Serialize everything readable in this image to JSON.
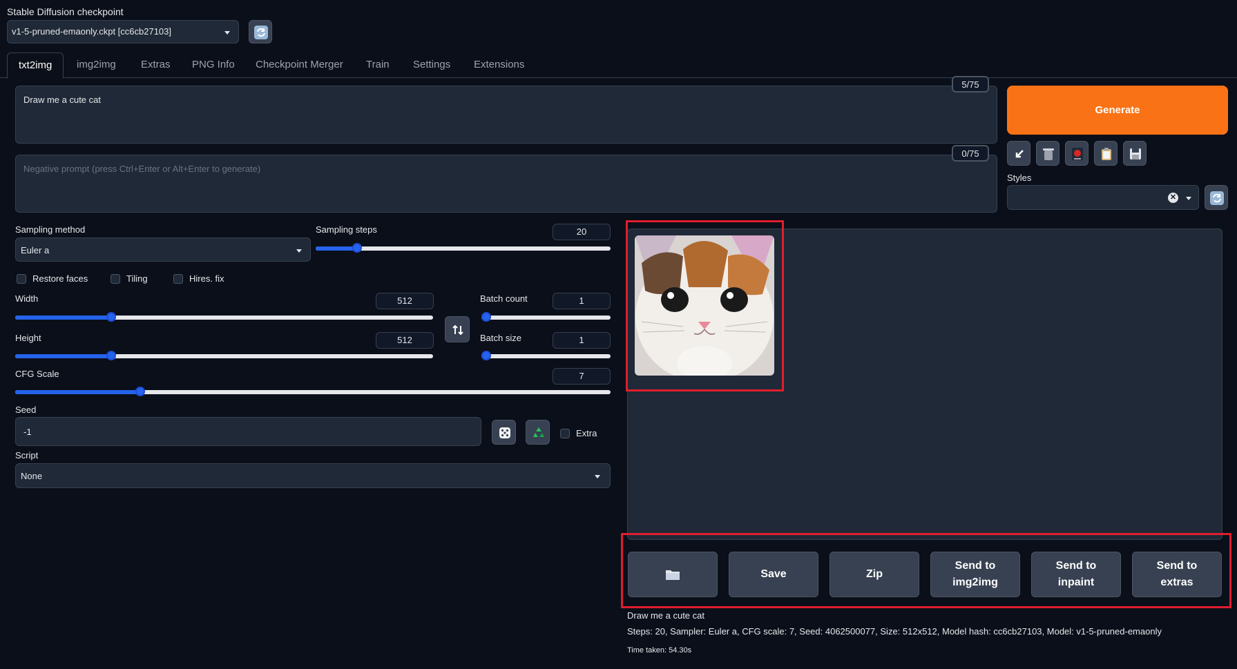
{
  "checkpoint": {
    "label": "Stable Diffusion checkpoint",
    "value": "v1-5-pruned-emaonly.ckpt [cc6cb27103]"
  },
  "tabs": [
    {
      "label": "txt2img"
    },
    {
      "label": "img2img"
    },
    {
      "label": "Extras"
    },
    {
      "label": "PNG Info"
    },
    {
      "label": "Checkpoint Merger"
    },
    {
      "label": "Train"
    },
    {
      "label": "Settings"
    },
    {
      "label": "Extensions"
    }
  ],
  "prompt": {
    "value": "Draw me a cute cat",
    "token_count": "5/75"
  },
  "negative_prompt": {
    "placeholder": "Negative prompt (press Ctrl+Enter or Alt+Enter to generate)",
    "token_count": "0/75"
  },
  "generate_label": "Generate",
  "styles": {
    "label": "Styles",
    "value": ""
  },
  "sampling": {
    "method_label": "Sampling method",
    "method_value": "Euler a",
    "steps_label": "Sampling steps",
    "steps_value": "20",
    "steps_fraction": 0.14
  },
  "options": {
    "restore_faces": "Restore faces",
    "tiling": "Tiling",
    "hires_fix": "Hires. fix"
  },
  "width": {
    "label": "Width",
    "value": "512",
    "fraction": 0.23
  },
  "height": {
    "label": "Height",
    "value": "512",
    "fraction": 0.23
  },
  "batch_count": {
    "label": "Batch count",
    "value": "1",
    "fraction": 0
  },
  "batch_size": {
    "label": "Batch size",
    "value": "1",
    "fraction": 0
  },
  "cfg_scale": {
    "label": "CFG Scale",
    "value": "7",
    "fraction": 0.21
  },
  "seed": {
    "label": "Seed",
    "value": "-1",
    "extra_label": "Extra"
  },
  "script": {
    "label": "Script",
    "value": "None"
  },
  "actions": {
    "save": "Save",
    "zip": "Zip",
    "send_img2img": "Send to img2img",
    "send_inpaint": "Send to inpaint",
    "send_extras": "Send to extras"
  },
  "output": {
    "prompt_text": "Draw me a cute cat",
    "params": "Steps: 20, Sampler: Euler a, CFG scale: 7, Seed: 4062500077, Size: 512x512, Model hash: cc6cb27103, Model: v1-5-pruned-emaonly",
    "time_taken": "Time taken: 54.30s"
  },
  "colors": {
    "background": "#0b0f19",
    "panel": "#1f2937",
    "accent": "#2563eb",
    "generate": "#f97316",
    "highlight": "#e11d2e"
  },
  "icons": [
    "refresh-icon",
    "arrow-icon",
    "trash-icon",
    "record-icon",
    "clipboard-icon",
    "save-icon",
    "swap-icon",
    "dice-icon",
    "recycle-icon",
    "folder-icon"
  ]
}
